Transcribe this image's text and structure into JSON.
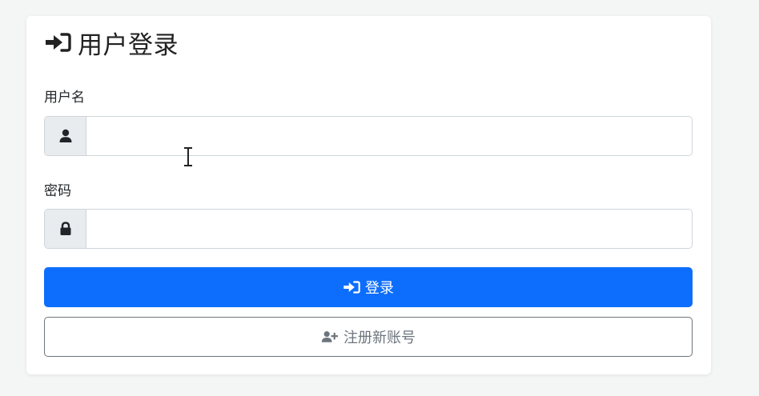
{
  "login_card": {
    "title": "用户登录",
    "username": {
      "label": "用户名",
      "value": "",
      "icon": "user-icon"
    },
    "password": {
      "label": "密码",
      "value": "",
      "icon": "lock-icon"
    },
    "login_button": {
      "label": "登录",
      "icon": "sign-in-icon",
      "color": "#0d6efd"
    },
    "register_button": {
      "label": "注册新账号",
      "icon": "user-plus-icon",
      "color": "#6c757d"
    }
  }
}
